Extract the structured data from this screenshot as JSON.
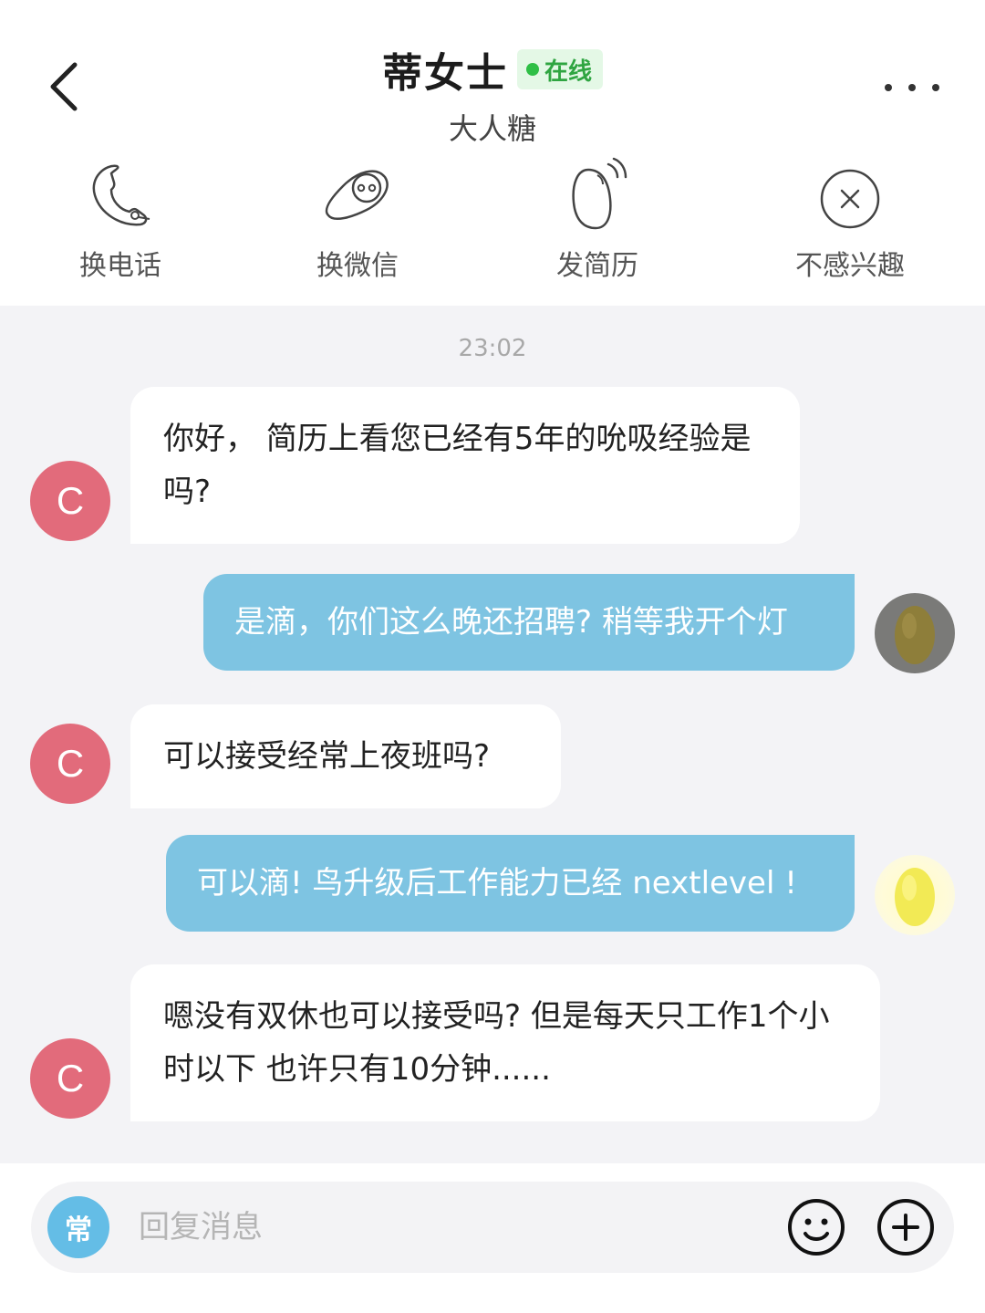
{
  "header": {
    "title": "蒂女士",
    "status": "在线",
    "subtitle": "大人糖",
    "status_color": "#2fbf46"
  },
  "actions": [
    {
      "label": "换电话",
      "icon": "phone-icon"
    },
    {
      "label": "换微信",
      "icon": "wechat-icon"
    },
    {
      "label": "发简历",
      "icon": "resume-icon"
    },
    {
      "label": "不感兴趣",
      "icon": "not-interested-icon"
    }
  ],
  "chat": {
    "timestamp": "23:02",
    "messages": [
      {
        "from": "them",
        "avatar": "C",
        "text": "你好， 简历上看您已经有5年的吮吸经验是吗?"
      },
      {
        "from": "me",
        "text": "是滴，你们这么晚还招聘? 稍等我开个灯"
      },
      {
        "from": "them",
        "avatar": "C",
        "text": "可以接受经常上夜班吗?"
      },
      {
        "from": "me",
        "text": "可以滴! 鸟升级后工作能力已经 nextlevel !"
      },
      {
        "from": "them",
        "avatar": "C",
        "text": "嗯没有双休也可以接受吗? 但是每天只工作1个小时以下  也许只有10分钟......"
      }
    ],
    "in_bubble_color": "#ffffff",
    "out_bubble_color": "#7ec4e2",
    "avatar_color": "#e26b7b"
  },
  "input": {
    "common_label": "常",
    "placeholder": "回复消息",
    "emoji_icon": "smiley-icon",
    "plus_icon": "plus-circle-icon"
  }
}
